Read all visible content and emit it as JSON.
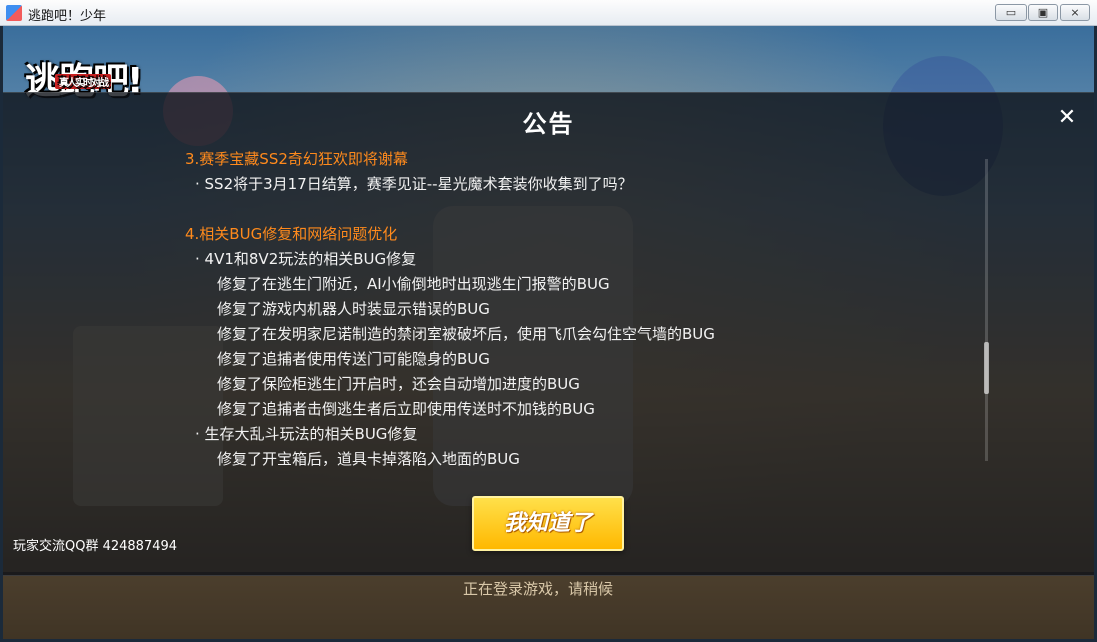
{
  "window": {
    "title": "逃跑吧！少年",
    "minimize_glyph": "▭",
    "restore_glyph": "▣",
    "close_glyph": "⨯"
  },
  "game": {
    "logo_text": "逃跑吧!",
    "logo_sub": "真人实时对战",
    "loading_text": "正在登录游戏，请稍候"
  },
  "notice": {
    "title": "公告",
    "close_glyph": "✕",
    "sections": [
      {
        "type": "heading",
        "text": "3.赛季宝藏SS2奇幻狂欢即将谢幕"
      },
      {
        "type": "bullet",
        "text": "· SS2将于3月17日结算，赛季见证--星光魔术套装你收集到了吗？"
      },
      {
        "type": "heading",
        "text": "4.相关BUG修复和网络问题优化"
      },
      {
        "type": "bullet",
        "text": "· 4V1和8V2玩法的相关BUG修复"
      },
      {
        "type": "item",
        "text": "修复了在逃生门附近，AI小偷倒地时出现逃生门报警的BUG"
      },
      {
        "type": "item",
        "text": "修复了游戏内机器人时装显示错误的BUG"
      },
      {
        "type": "item",
        "text": "修复了在发明家尼诺制造的禁闭室被破坏后，使用飞爪会勾住空气墙的BUG"
      },
      {
        "type": "item",
        "text": "修复了追捕者使用传送门可能隐身的BUG"
      },
      {
        "type": "item",
        "text": "修复了保险柜逃生门开启时，还会自动增加进度的BUG"
      },
      {
        "type": "item",
        "text": "修复了追捕者击倒逃生者后立即使用传送时不加钱的BUG"
      },
      {
        "type": "bullet",
        "text": "· 生存大乱斗玩法的相关BUG修复"
      },
      {
        "type": "item",
        "text": "修复了开宝箱后，道具卡掉落陷入地面的BUG"
      }
    ],
    "qq_group": "玩家交流QQ群 424887494",
    "confirm_label": "我知道了"
  },
  "colors": {
    "heading": "#ff8a1c",
    "button": "#ffc81e"
  }
}
